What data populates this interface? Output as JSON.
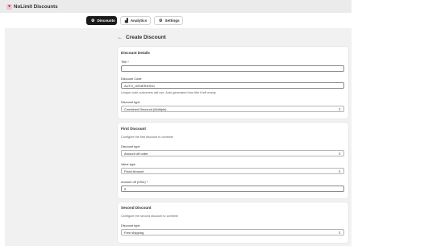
{
  "app": {
    "title": "NoLimit Discounts",
    "icon": "app-logo-icon"
  },
  "nav": {
    "tabs": [
      {
        "label": "Discounts",
        "icon": "discount-icon",
        "active": true
      },
      {
        "label": "Analytics",
        "icon": "chart-icon",
        "active": false
      },
      {
        "label": "Settings",
        "icon": "gear-icon",
        "active": false
      }
    ]
  },
  "page": {
    "title": "Create Discount",
    "back_icon": "arrow-left-icon"
  },
  "details": {
    "heading": "Discount Details",
    "title_label": "Title *",
    "title_value": "",
    "code_label": "Discount Code",
    "code_value": "AUTO_GENERATED",
    "code_help": "Unique code customers will use. Auto-generated from title if left empty.",
    "type_label": "Discount type",
    "type_value": "Combined Discount (Multiple)"
  },
  "first": {
    "heading": "First Discount",
    "help": "Configure the first discount to combine",
    "type_label": "Discount type",
    "type_value": "Amount off order",
    "value_type_label": "Value type",
    "value_type_value": "Fixed Amount",
    "amount_label": "Amount off (USD) *",
    "amount_value": "5"
  },
  "second": {
    "heading": "Second Discount",
    "help": "Configure the second discount to combine",
    "type_label": "Discount type",
    "type_value": "Free shipping"
  },
  "colors": {
    "active_tab": "#1a1a1a",
    "background": "#f1f1f1",
    "card": "#ffffff"
  }
}
